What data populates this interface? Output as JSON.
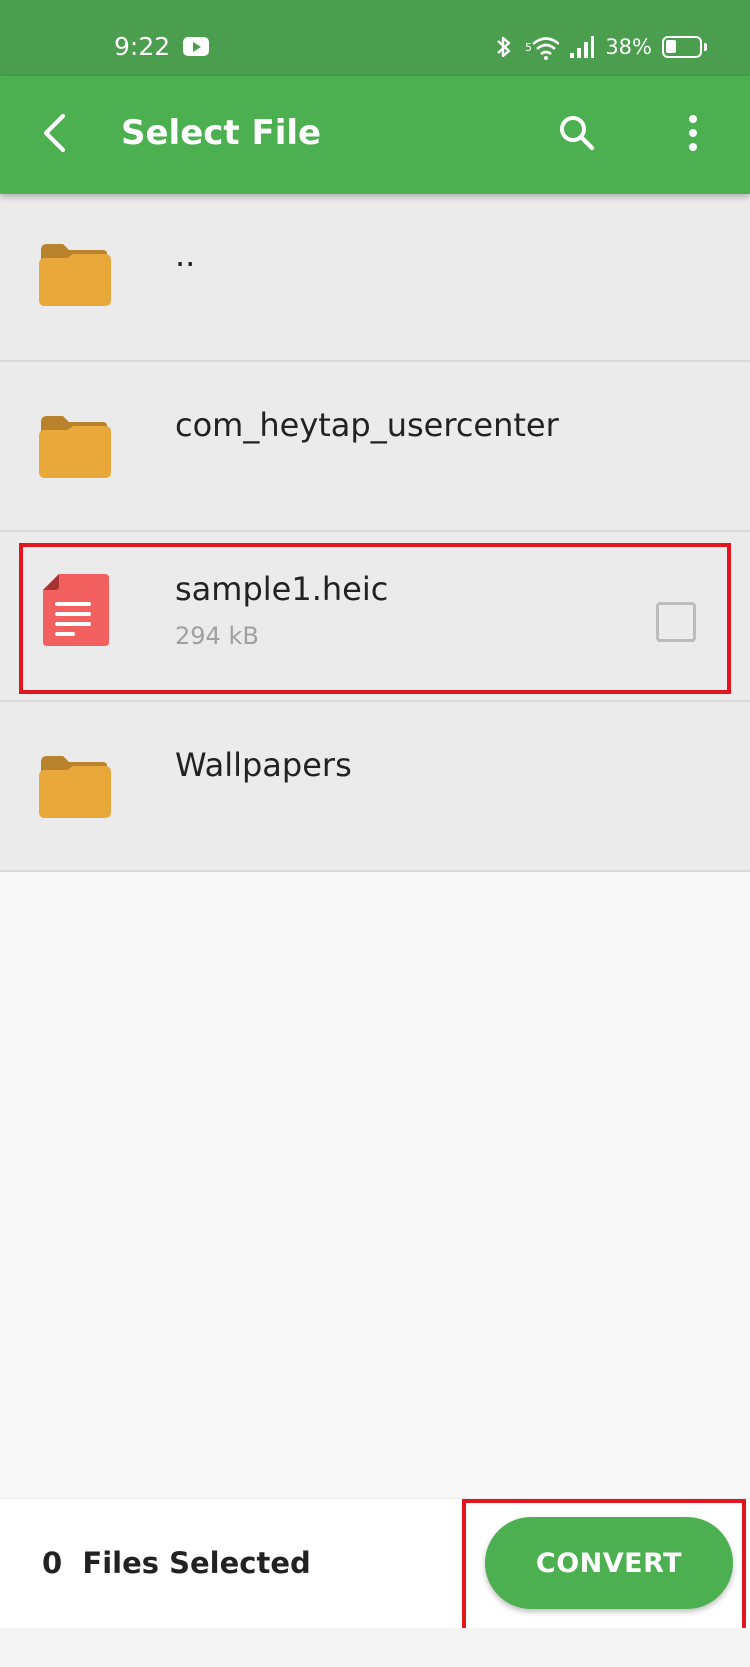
{
  "status_bar": {
    "time": "9:22",
    "battery": "38%",
    "icons": [
      "youtube-icon",
      "bluetooth-icon",
      "wifi-icon",
      "signal-icon",
      "battery-icon"
    ]
  },
  "app_bar": {
    "title": "Select File",
    "icons": [
      "back-arrow-icon",
      "search-icon",
      "more-vert-icon"
    ]
  },
  "files": [
    {
      "name": "..",
      "type": "folder",
      "icon": "folder-icon"
    },
    {
      "name": "com_heytap_usercenter",
      "type": "folder",
      "icon": "folder-icon"
    },
    {
      "name": "sample1.heic",
      "type": "file",
      "size": "294 kB",
      "icon": "document-icon",
      "checked": false
    },
    {
      "name": "Wallpapers",
      "type": "folder",
      "icon": "folder-icon"
    }
  ],
  "bottom_bar": {
    "count": "0",
    "count_label": "Files Selected",
    "convert_label": "CONVERT"
  },
  "colors": {
    "status_bar": "#4a9e4d",
    "app_bar": "#4caf50",
    "folder": "#e8a93a",
    "folder_tab": "#b9822c",
    "document": "#f26060",
    "highlight": "#e3161d"
  }
}
